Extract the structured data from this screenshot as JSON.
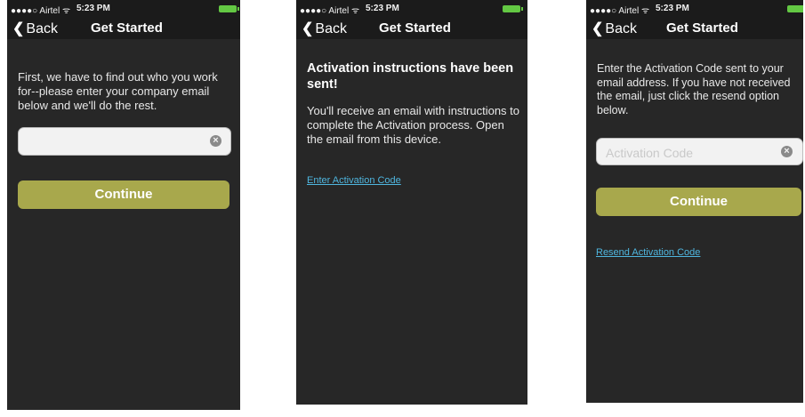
{
  "status_bar": {
    "carrier": "●●●●○ Airtel ᯤ",
    "time": "5:23 PM"
  },
  "nav": {
    "back_label": "Back",
    "title": "Get Started"
  },
  "screen1": {
    "instructions": "First, we have to find out who you work for--please enter your company email below and we'll do the rest.",
    "email_value": "",
    "continue_label": "Continue"
  },
  "screen2": {
    "heading": "Activation instructions have been sent!",
    "body": "You'll receive an email with instructions to complete the Activation process. Open the email from this device.",
    "link_label": "Enter Activation Code"
  },
  "screen3": {
    "instructions": "Enter the Activation Code sent to your email address. If you have not received the email, just click the resend option below.",
    "code_placeholder": "Activation Code",
    "continue_label": "Continue",
    "link_label": "Resend Activation Code"
  },
  "colors": {
    "background": "#272727",
    "button": "#a8a84c",
    "link": "#4fb6df",
    "battery": "#63c843"
  },
  "icons": {
    "back": "chevron-left-icon",
    "clear": "clear-circle-x-icon",
    "battery": "battery-icon"
  }
}
